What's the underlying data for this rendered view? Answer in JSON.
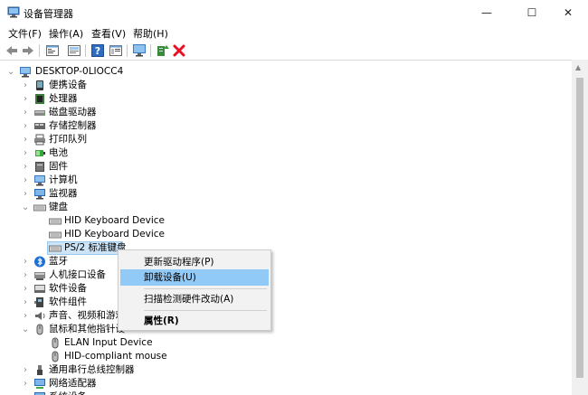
{
  "window": {
    "title": "设备管理器",
    "minimize_glyph": "—",
    "maximize_glyph": "☐",
    "close_glyph": "✕"
  },
  "menu": [
    {
      "label": "文件(F)"
    },
    {
      "label": "操作(A)"
    },
    {
      "label": "查看(V)"
    },
    {
      "label": "帮助(H)"
    }
  ],
  "toolbar": {
    "icons": [
      "back-arrow-icon",
      "forward-arrow-icon",
      "properties-icon",
      "update-icon",
      "help-icon",
      "view-icon",
      "scan-monitor-icon",
      "add-driver-icon",
      "remove-device-icon"
    ]
  },
  "tree": {
    "root": "DESKTOP-0LIOCC4",
    "categories": [
      {
        "label": "便携设备",
        "expander": "›"
      },
      {
        "label": "处理器",
        "expander": "›"
      },
      {
        "label": "磁盘驱动器",
        "expander": "›"
      },
      {
        "label": "存储控制器",
        "expander": "›"
      },
      {
        "label": "打印队列",
        "expander": "›"
      },
      {
        "label": "电池",
        "expander": "›"
      },
      {
        "label": "固件",
        "expander": "›"
      },
      {
        "label": "计算机",
        "expander": "›"
      },
      {
        "label": "监视器",
        "expander": "›"
      },
      {
        "label": "键盘",
        "expander": "⌄"
      },
      {
        "label": "HID Keyboard Device",
        "expander": ""
      },
      {
        "label": "HID Keyboard Device",
        "expander": ""
      },
      {
        "label": "PS/2 标准键盘",
        "expander": ""
      },
      {
        "label": "蓝牙",
        "expander": "›"
      },
      {
        "label": "人机接口设备",
        "expander": "›"
      },
      {
        "label": "软件设备",
        "expander": "›"
      },
      {
        "label": "软件组件",
        "expander": "›"
      },
      {
        "label": "声音、视频和游戏",
        "expander": "›"
      },
      {
        "label": "鼠标和其他指针设",
        "expander": "⌄"
      },
      {
        "label": "ELAN Input Device",
        "expander": ""
      },
      {
        "label": "HID-compliant mouse",
        "expander": ""
      },
      {
        "label": "通用串行总线控制器",
        "expander": "›"
      },
      {
        "label": "网络适配器",
        "expander": "›"
      },
      {
        "label": "系统设备",
        "expander": "›"
      }
    ]
  },
  "context_menu": {
    "items": [
      {
        "label": "更新驱动程序(P)"
      },
      {
        "label": "卸载设备(U)"
      },
      {
        "label": "扫描检测硬件改动(A)"
      },
      {
        "label": "属性(R)"
      }
    ]
  },
  "colors": {
    "selection": "#cce4f7",
    "menu_hover": "#91c9f7",
    "close_icon": "#e81123",
    "bluetooth": "#1e6fd6"
  }
}
